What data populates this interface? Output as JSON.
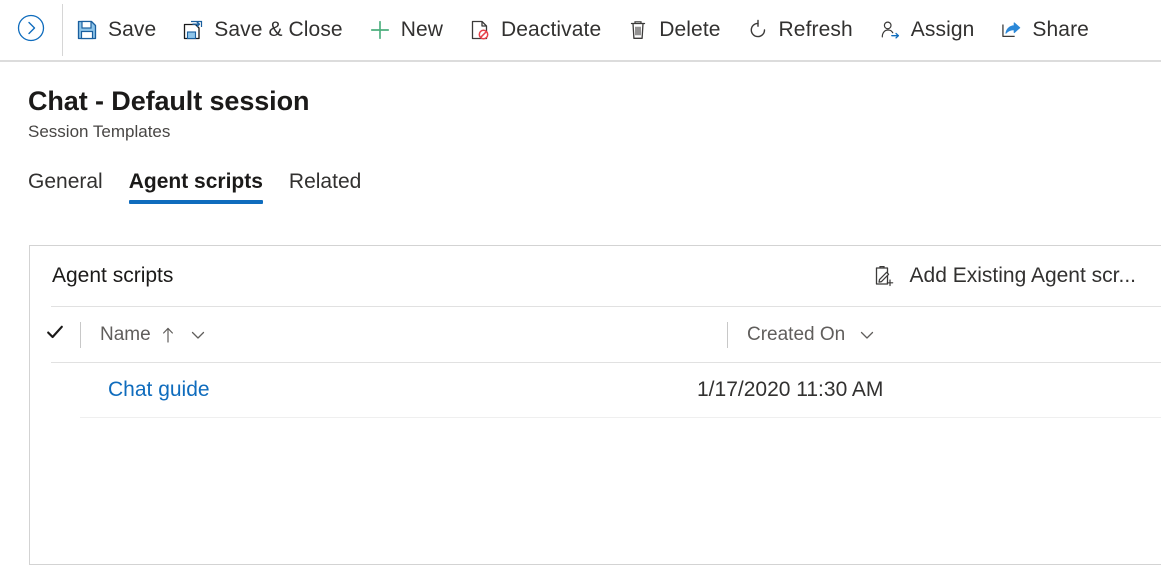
{
  "commandbar": {
    "back_button": {
      "icon": "back-circle-icon"
    },
    "buttons": [
      {
        "label": "Save",
        "icon": "save-floppy-icon"
      },
      {
        "label": "Save & Close",
        "icon": "save-and-close-icon"
      },
      {
        "label": "New",
        "icon": "plus-icon"
      },
      {
        "label": "Deactivate",
        "icon": "deactivate-icon"
      },
      {
        "label": "Delete",
        "icon": "trash-icon"
      },
      {
        "label": "Refresh",
        "icon": "refresh-icon"
      },
      {
        "label": "Assign",
        "icon": "assign-person-icon"
      },
      {
        "label": "Share",
        "icon": "share-arrow-icon"
      }
    ]
  },
  "header": {
    "title": "Chat - Default session",
    "subtitle": "Session Templates"
  },
  "tabs": [
    {
      "label": "General",
      "active": false
    },
    {
      "label": "Agent scripts",
      "active": true
    },
    {
      "label": "Related",
      "active": false
    }
  ],
  "subgrid": {
    "title": "Agent scripts",
    "action": {
      "label": "Add Existing Agent scr...",
      "icon": "add-existing-record-icon"
    },
    "columns": [
      {
        "label": "Name",
        "sort": "ascending",
        "sort_icon": "arrow-up-icon",
        "menu_icon": "chevron-down-icon"
      },
      {
        "label": "Created On",
        "sort": "none",
        "menu_icon": "chevron-down-icon"
      }
    ],
    "select_all_icon": "checkmark-icon",
    "rows": [
      {
        "name": "Chat guide",
        "created_on": "1/17/2020 11:30 AM"
      }
    ]
  },
  "colors": {
    "accent": "#0f6cbd",
    "link": "#0f6cbd",
    "new_green": "#4caf7d",
    "deactivate_red": "#e8414a",
    "text": "#323130",
    "muted_text": "#605e5c",
    "border": "#d3d3d3"
  }
}
